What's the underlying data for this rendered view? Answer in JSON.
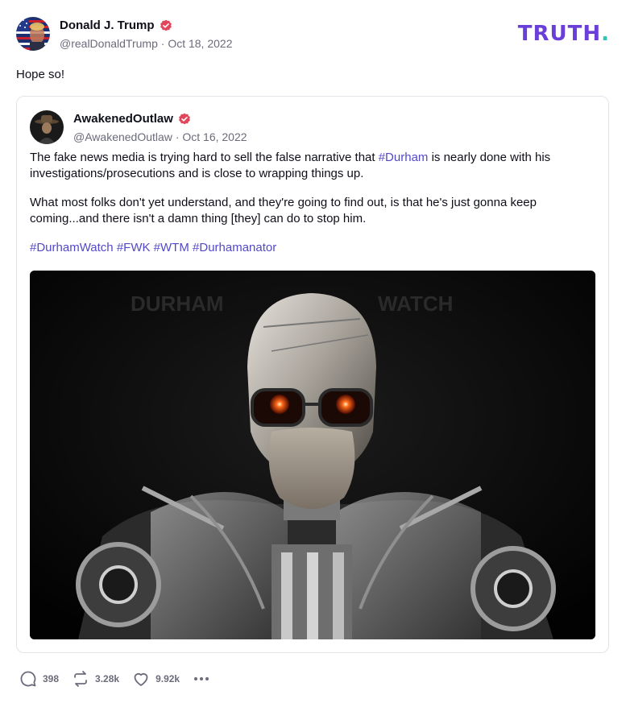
{
  "post": {
    "author": {
      "display_name": "Donald J. Trump",
      "handle": "@realDonaldTrump",
      "date": "Oct 18, 2022",
      "avatar_icon": "flag-avatar-icon",
      "verified_icon": "verified-badge-icon"
    },
    "text": "Hope so!",
    "logo": {
      "main": "TRUTH",
      "dot": "."
    }
  },
  "quoted": {
    "author": {
      "display_name": "AwakenedOutlaw",
      "handle": "@AwakenedOutlaw",
      "date": "Oct 16, 2022",
      "avatar_icon": "cowboy-avatar-icon",
      "verified_icon": "verified-badge-icon"
    },
    "para1": {
      "before": "The fake news media is trying hard to sell the false narrative that ",
      "tag": "#Durham",
      "after": " is nearly done with his investigations/prosecutions and is close to wrapping things up."
    },
    "para2": "What most folks don't yet understand, and they're going to find out, is that he's just gonna keep coming...and there isn't a damn thing [they] can do to stop him.",
    "hashtags": [
      "#DurhamWatch",
      "#FWK",
      "#WTM",
      "#Durhamanator"
    ],
    "media": {
      "overlay_left": "DURHAM",
      "overlay_right": "WATCH"
    }
  },
  "actions": {
    "replies": "398",
    "retruths": "3.28k",
    "likes": "9.92k"
  },
  "colors": {
    "accent": "#5448c8",
    "logo": "#6a3ed8",
    "logo_dot": "#2ec4b6",
    "verified": "#e0475b",
    "muted": "#6b6b7b"
  }
}
